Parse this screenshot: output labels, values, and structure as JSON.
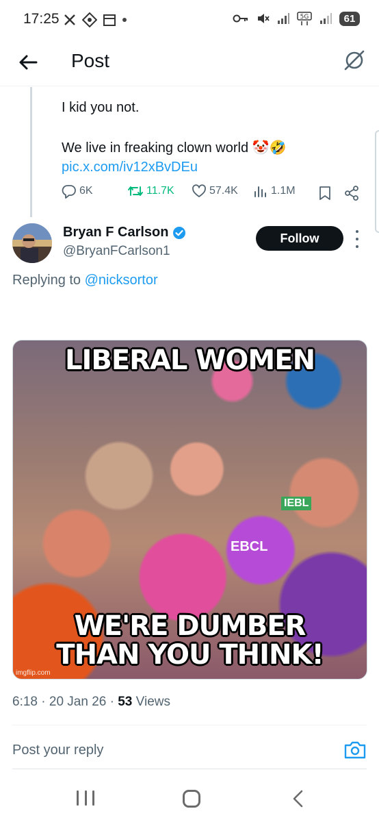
{
  "status_bar": {
    "time": "17:25",
    "battery": "61",
    "icons_left": [
      "x-app-icon",
      "vpn-icon",
      "calendar-icon",
      "dot-icon"
    ],
    "icons_right": [
      "key-icon",
      "mute-icon",
      "signal-r-icon",
      "5g-icon",
      "signal-icon",
      "battery-icon"
    ]
  },
  "header": {
    "title": "Post"
  },
  "tweet": {
    "line1": "I kid you not.",
    "line2": "We live in freaking clown world",
    "emojis": "🤡🤣",
    "link": "pic.x.com/iv12xBvDEu",
    "actions": {
      "replies": "6K",
      "reposts": "11.7K",
      "likes": "57.4K",
      "views": "1.1M"
    }
  },
  "reply": {
    "author_name": "Bryan F Carlson",
    "handle": "@BryanFCarlson1",
    "follow_label": "Follow",
    "replying_prefix": "Replying to ",
    "replying_to": "@nicksortor",
    "meme": {
      "top_text": "LIBERAL WOMEN",
      "bottom_text_1": "WE'RE DUMBER",
      "bottom_text_2": "THAN YOU THINK!",
      "watermark": "imgflip.com",
      "sign_1": "IEBL",
      "sign_2": "EBCL"
    },
    "time": "6:18",
    "date": "20 Jan 26",
    "views_count": "53",
    "views_label": "Views"
  },
  "composer": {
    "placeholder": "Post your reply"
  },
  "colors": {
    "accent": "#1d9bf0",
    "repost_green": "#00ba7c",
    "text_primary": "#0f1419",
    "text_secondary": "#536471",
    "follow_bg": "#0f1419"
  }
}
